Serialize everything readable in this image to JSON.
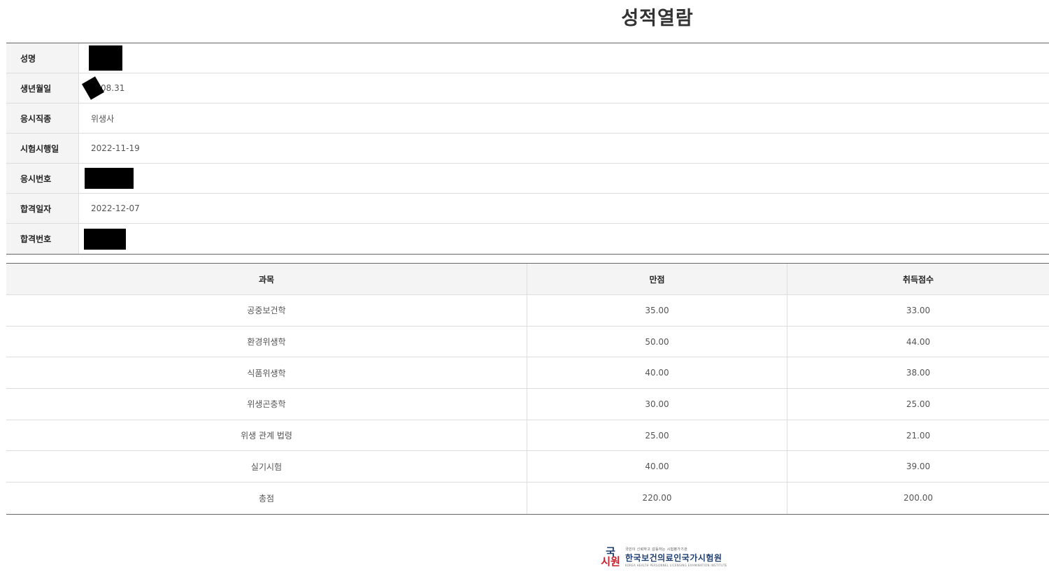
{
  "title": "성적열람",
  "info": {
    "rows": [
      {
        "label": "성명",
        "value": ""
      },
      {
        "label": "생년월일",
        "value": "08.31"
      },
      {
        "label": "응시직종",
        "value": "위생사"
      },
      {
        "label": "시험시행일",
        "value": "2022-11-19"
      },
      {
        "label": "응시번호",
        "value": ""
      },
      {
        "label": "합격일자",
        "value": "2022-12-07"
      },
      {
        "label": "합격번호",
        "value": ""
      }
    ]
  },
  "scores": {
    "headers": [
      "과목",
      "만점",
      "취득점수"
    ],
    "rows": [
      [
        "공중보건학",
        "35.00",
        "33.00"
      ],
      [
        "환경위생학",
        "50.00",
        "44.00"
      ],
      [
        "식품위생학",
        "40.00",
        "38.00"
      ],
      [
        "위생곤충학",
        "30.00",
        "25.00"
      ],
      [
        "위생 관계 법령",
        "25.00",
        "21.00"
      ],
      [
        "실기시험",
        "40.00",
        "39.00"
      ],
      [
        "총점",
        "220.00",
        "200.00"
      ]
    ]
  },
  "footer": {
    "logo_mark_top": "국",
    "logo_mark_bottom": "시원",
    "logo_tagline": "국민이 신뢰하고 감동하는 시험평가기관",
    "logo_name": "한국보건의료인국가시험원",
    "logo_english": "KOREA HEALTH PERSONNEL LICENSING EXAMINATION INSTITUTE"
  }
}
